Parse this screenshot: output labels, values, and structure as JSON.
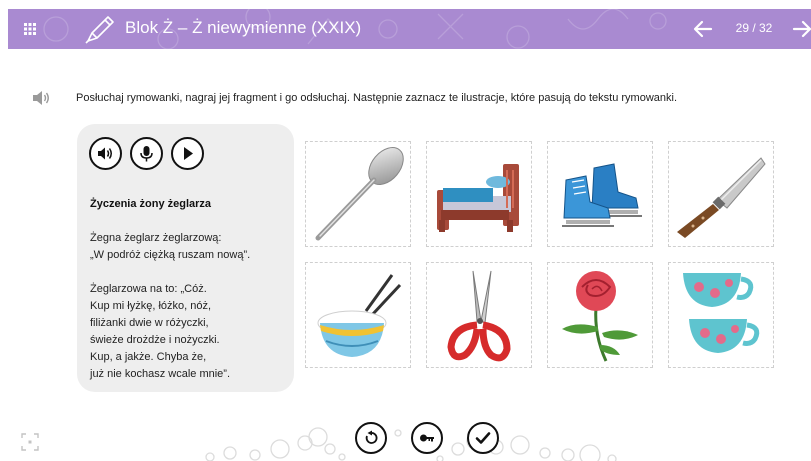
{
  "header": {
    "title": "Blok Ż – Ż niewymienne (XXIX)",
    "page": "29 / 32",
    "background_color": "#a98ad1",
    "menu_icon": "grid-icon",
    "back_icon": "arrow-left-icon",
    "forward_icon": "arrow-right-icon"
  },
  "instruction": {
    "text": "Posłuchaj rymowanki, nagraj jej fragment i go odsłuchaj. Następnie zaznacz te ilustracje, które pasują do tekstu rymowanki.",
    "icon": "speaker-icon"
  },
  "controls": [
    "speaker-icon",
    "microphone-icon",
    "play-icon"
  ],
  "poem": {
    "title": "Życzenia żony żeglarza",
    "lines": [
      "Żegna żeglarz żeglarzową:",
      "„W podróż ciężką ruszam nową”.",
      "",
      "Żeglarzowa na to: „Cóż.",
      "Kup mi łyżkę, łóżko, nóż,",
      "filiżanki dwie w różyczki,",
      "świeże drożdże i nożyczki.",
      "Kup, a jakże. Chyba że,",
      "już nie kochasz wcale mnie”."
    ]
  },
  "images": [
    "spoon",
    "bed",
    "ice-skates",
    "knife",
    "rice-bowl",
    "scissors",
    "rose",
    "teacups"
  ],
  "bottom_buttons": [
    "retry-icon",
    "key-icon",
    "check-icon"
  ]
}
